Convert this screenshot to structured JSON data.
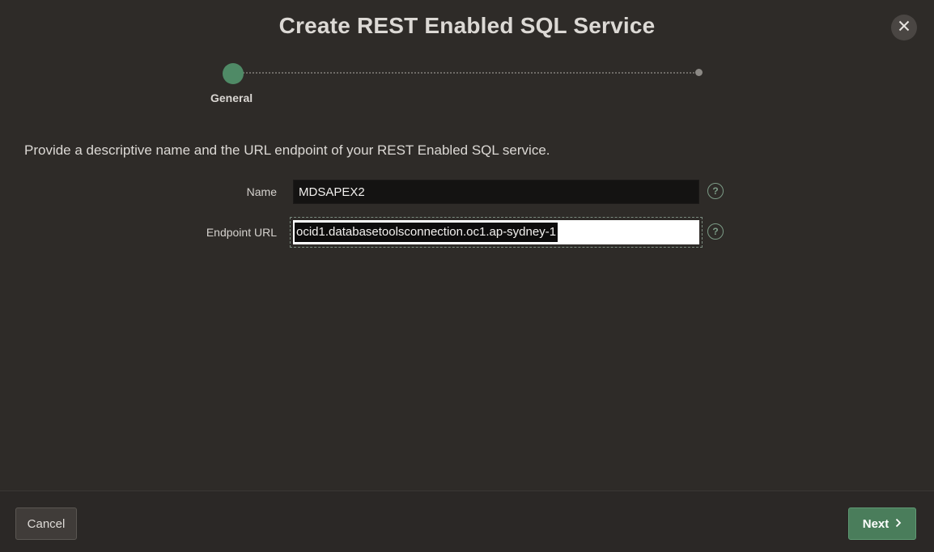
{
  "dialog": {
    "title": "Create REST Enabled SQL Service",
    "close_icon": "close-icon"
  },
  "wizard": {
    "steps": [
      {
        "label": "General",
        "state": "active"
      },
      {
        "label": "",
        "state": "pending"
      }
    ]
  },
  "form": {
    "instructions": "Provide a descriptive name and the URL endpoint of your REST Enabled SQL service.",
    "name_label": "Name",
    "name_value": "MDSAPEX2",
    "endpoint_label": "Endpoint URL",
    "endpoint_value": "ocid1.databasetoolsconnection.oc1.ap-sydney-1",
    "help_icon": "help-icon"
  },
  "footer": {
    "cancel_label": "Cancel",
    "next_label": "Next"
  },
  "colors": {
    "background": "#2e2b28",
    "accent": "#4a7d5b",
    "step_active": "#4f8a66"
  }
}
